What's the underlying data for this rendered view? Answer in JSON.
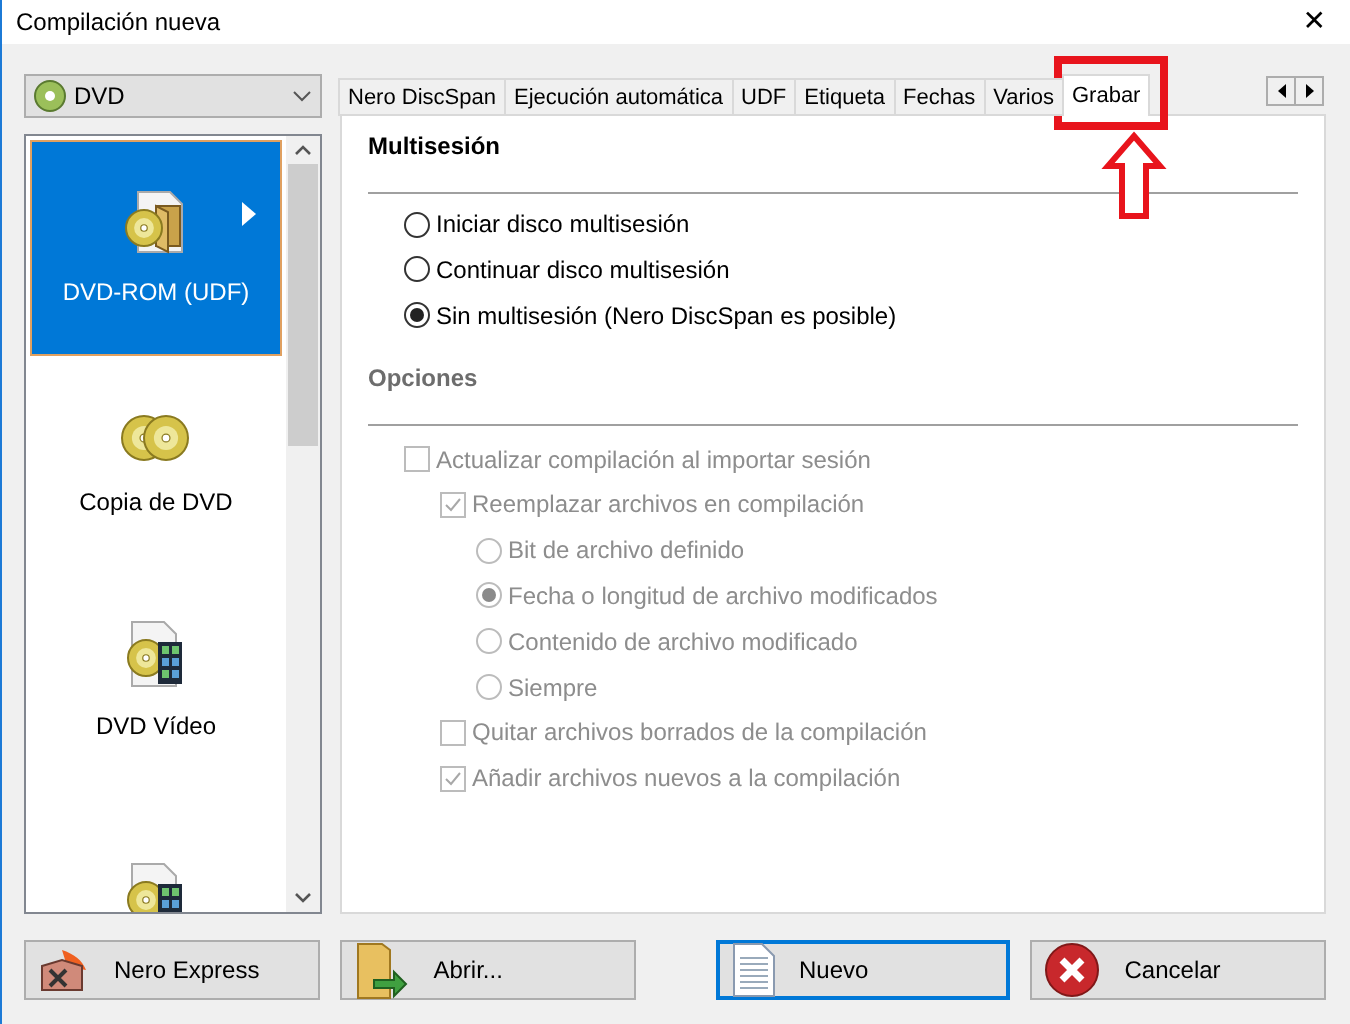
{
  "window": {
    "title": "Compilación nueva",
    "close": "✕"
  },
  "disc_type": {
    "value": "DVD"
  },
  "projects": [
    {
      "label": "DVD-ROM (UDF)",
      "kind": "disc-folder",
      "selected": true
    },
    {
      "label": "Copia de DVD",
      "kind": "disc-pair",
      "selected": false
    },
    {
      "label": "DVD Vídeo",
      "kind": "disc-film",
      "selected": false
    },
    {
      "kind": "disc-film",
      "selected": false
    }
  ],
  "tabs": [
    {
      "label": "Nero DiscSpan",
      "selected": false
    },
    {
      "label": "Ejecución automática",
      "selected": false
    },
    {
      "label": "UDF",
      "selected": false
    },
    {
      "label": "Etiqueta",
      "selected": false
    },
    {
      "label": "Fechas",
      "selected": false
    },
    {
      "label": "Varios",
      "selected": false
    },
    {
      "label": "Grabar",
      "selected": true
    }
  ],
  "multisession": {
    "title": "Multisesión",
    "options": [
      {
        "label": "Iniciar disco multisesión",
        "selected": false
      },
      {
        "label": "Continuar disco multisesión",
        "selected": false
      },
      {
        "label": "Sin multisesión (Nero DiscSpan es posible)",
        "selected": true
      }
    ]
  },
  "options": {
    "title": "Opciones",
    "items": [
      {
        "kind": "checkbox",
        "label": "Actualizar compilación al importar sesión",
        "checked": false,
        "disabled": true,
        "children": [
          {
            "kind": "checkbox",
            "label": "Reemplazar archivos en compilación",
            "checked": true,
            "disabled": true,
            "children": [
              {
                "kind": "radio",
                "label": "Bit de archivo definido",
                "selected": false,
                "disabled": true
              },
              {
                "kind": "radio",
                "label": "Fecha o longitud de archivo modificados",
                "selected": true,
                "disabled": true
              },
              {
                "kind": "radio",
                "label": "Contenido de archivo modificado",
                "selected": false,
                "disabled": true
              },
              {
                "kind": "radio",
                "label": "Siempre",
                "selected": false,
                "disabled": true
              }
            ]
          },
          {
            "kind": "checkbox",
            "label": "Quitar archivos borrados de la compilación",
            "checked": false,
            "disabled": true
          },
          {
            "kind": "checkbox",
            "label": "Añadir archivos nuevos a la compilación",
            "checked": true,
            "disabled": true
          }
        ]
      }
    ]
  },
  "buttons": [
    {
      "label": "Nero Express",
      "kind": "express",
      "default": false
    },
    {
      "label": "Abrir...",
      "kind": "open",
      "default": false
    },
    {
      "label": "Nuevo",
      "kind": "new",
      "default": true
    },
    {
      "label": "Cancelar",
      "kind": "cancel",
      "default": false
    }
  ]
}
